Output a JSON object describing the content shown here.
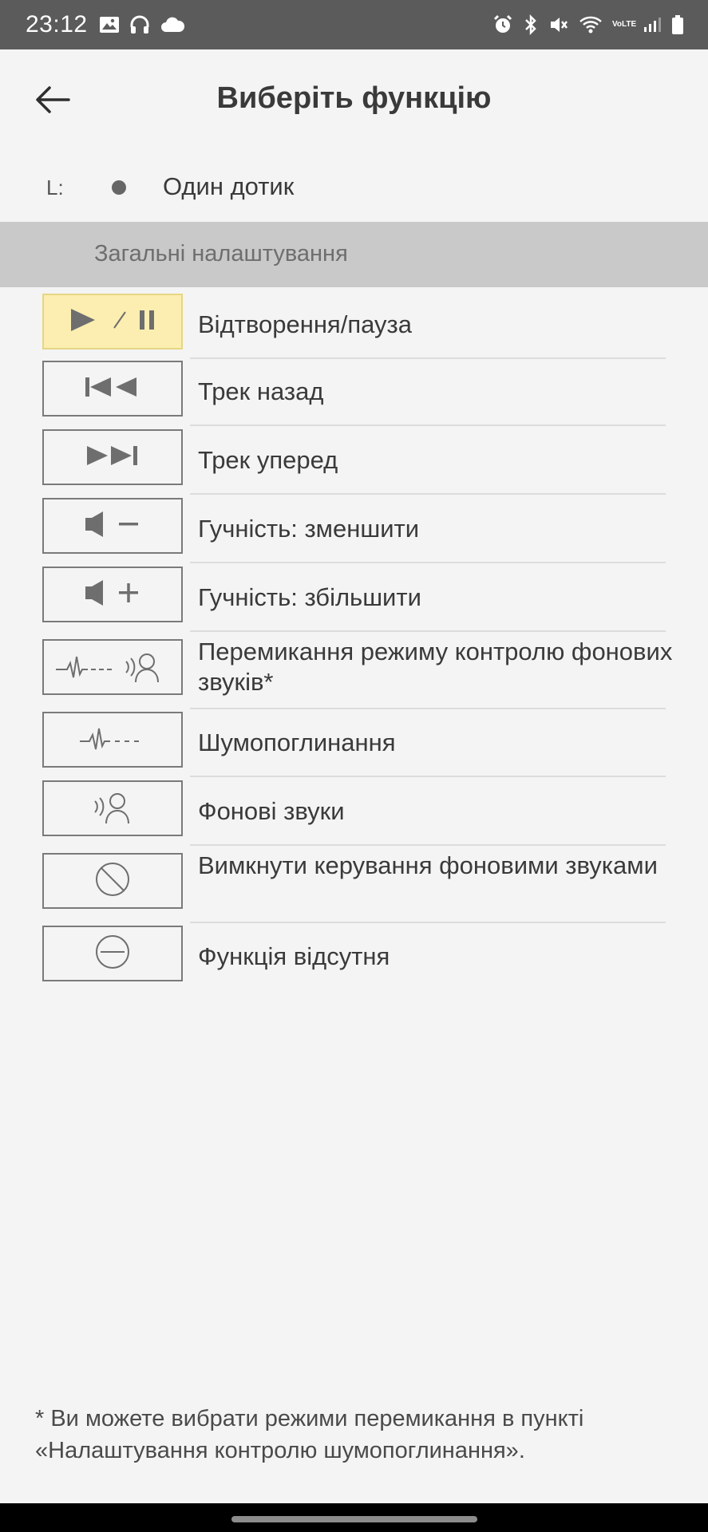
{
  "status_bar": {
    "time": "23:12",
    "left_icons": [
      "image-icon",
      "headphones-icon",
      "cloud-icon"
    ],
    "right_icons": [
      "alarm-icon",
      "bluetooth-icon",
      "mute-icon",
      "wifi-icon",
      "volte-icon",
      "signal-icon",
      "battery-icon"
    ],
    "volte_text": "VoLTE"
  },
  "header": {
    "title": "Виберіть функцію",
    "back_icon": "arrow-left-icon"
  },
  "touch": {
    "side_label": "L:",
    "gesture_label": "Один дотик"
  },
  "section": {
    "title": "Загальні налаштування"
  },
  "options": [
    {
      "label": "Відтворення/пауза",
      "icon": "play-pause-icon",
      "selected": true
    },
    {
      "label": "Трек назад",
      "icon": "previous-track-icon",
      "selected": false
    },
    {
      "label": "Трек уперед",
      "icon": "next-track-icon",
      "selected": false
    },
    {
      "label": "Гучність: зменшити",
      "icon": "volume-down-icon",
      "selected": false
    },
    {
      "label": "Гучність: збільшити",
      "icon": "volume-up-icon",
      "selected": false
    },
    {
      "label": "Перемикання режиму контролю фонових звуків*",
      "icon": "ambient-toggle-icon",
      "selected": false
    },
    {
      "label": "Шумопоглинання",
      "icon": "noise-cancelling-icon",
      "selected": false
    },
    {
      "label": "Фонові звуки",
      "icon": "ambient-sound-icon",
      "selected": false
    },
    {
      "label": "Вимкнути керування фоновими звуками",
      "icon": "ambient-off-icon",
      "selected": false
    },
    {
      "label": "Функція відсутня",
      "icon": "no-function-icon",
      "selected": false
    }
  ],
  "footnote": "* Ви можете вибрати режими перемикання в пункті «Налаштування контролю шумопоглинання».",
  "colors": {
    "status_bar": "#5b5b5b",
    "background": "#f4f4f4",
    "section_header": "#c9c9c9",
    "selected_fill": "#fbeeb0",
    "icon_gray": "#6e6e6e"
  }
}
